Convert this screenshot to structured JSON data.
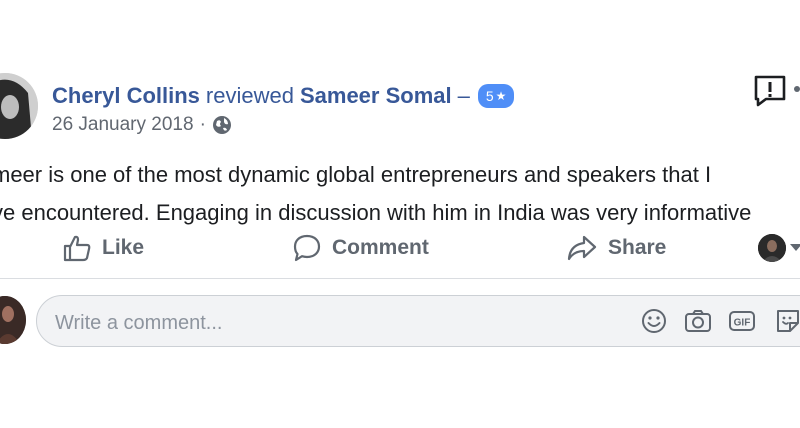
{
  "post": {
    "author": "Cheryl Collins",
    "verb": "reviewed",
    "page": "Sameer Somal",
    "dash": "–",
    "rating": "5",
    "rating_star": "★",
    "date": "26 January 2018",
    "dot": "·",
    "privacy_icon": "globe-icon",
    "review_lines": [
      "meer is one of the most dynamic global entrepreneurs and speakers that I",
      "ve encountered. Engaging in discussion with him in India was very informative"
    ]
  },
  "actions": {
    "like": "Like",
    "comment": "Comment",
    "share": "Share"
  },
  "comment_box": {
    "placeholder": "Write a comment...",
    "icons": [
      "emoji-icon",
      "camera-icon",
      "gif-icon",
      "sticker-icon"
    ]
  },
  "colors": {
    "link": "#385898",
    "badge": "#4f8ef7",
    "action_text": "#606770",
    "input_bg": "#f2f3f5"
  }
}
